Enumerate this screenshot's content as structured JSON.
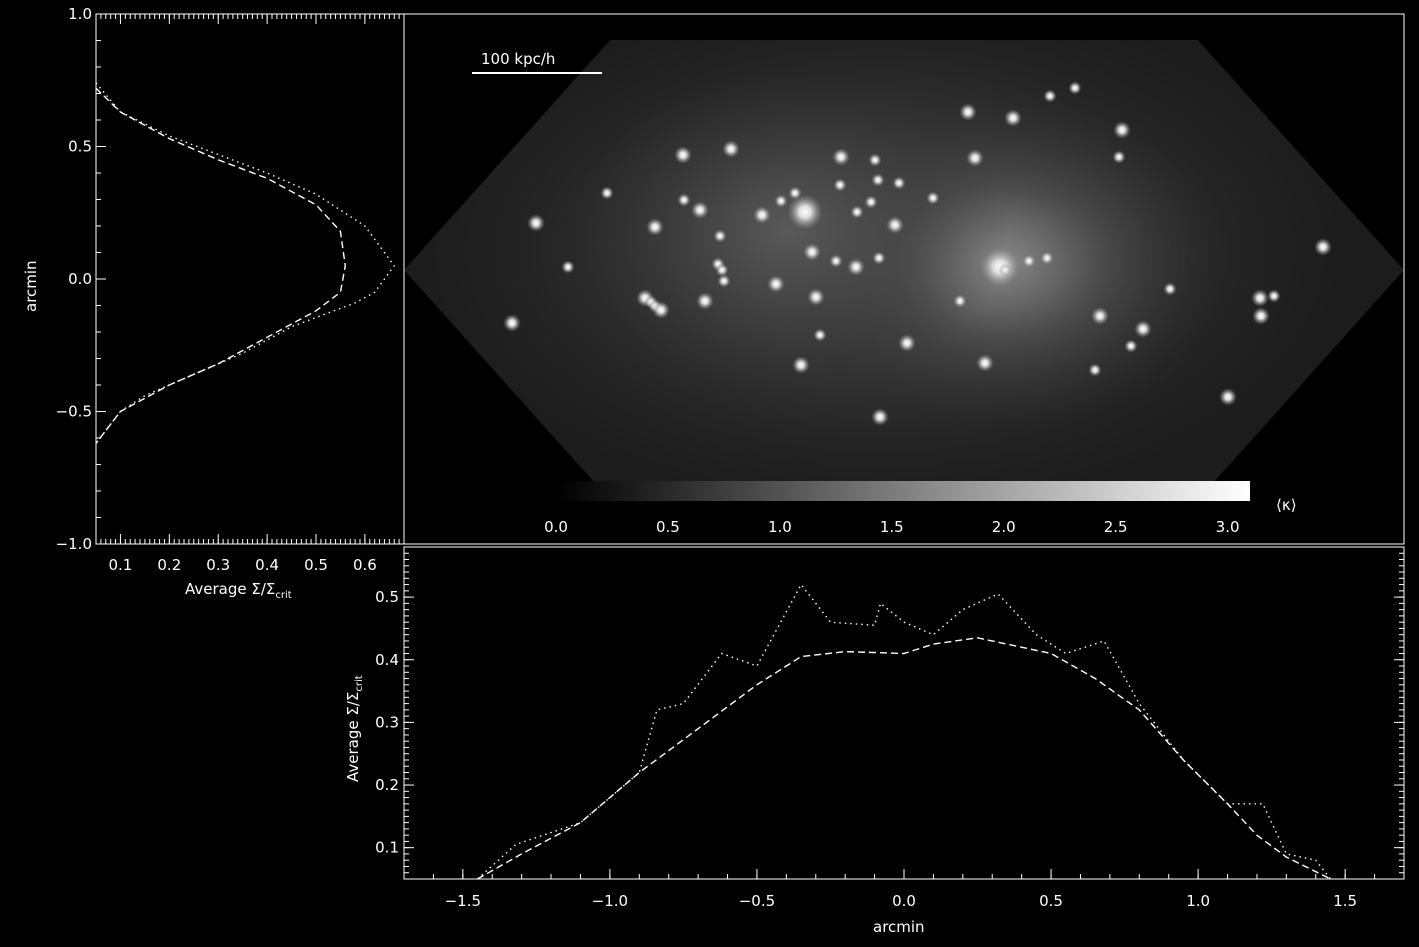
{
  "chart_data": [
    {
      "type": "heatmap",
      "panel": "map",
      "scale_bar_label": "100 kpc/h",
      "colorbar": {
        "label": "⟨κ⟩",
        "ticks": [
          "0.0",
          "0.5",
          "1.0",
          "1.5",
          "2.0",
          "2.5",
          "3.0"
        ],
        "range": [
          0.0,
          3.1
        ],
        "colors": [
          "#000000",
          "#ffffff"
        ]
      }
    },
    {
      "type": "line",
      "panel": "left-profile",
      "xlabel": "Average Σ/Σ",
      "xlabel_sub": "crit",
      "ylabel": "arcmin",
      "xticks": [
        "0.1",
        "0.2",
        "0.3",
        "0.4",
        "0.5",
        "0.6"
      ],
      "yticks": [
        "1.0",
        "0.5",
        "0.0",
        "−0.5",
        "−1.0"
      ],
      "xlim": [
        0.05,
        0.68
      ],
      "ylim": [
        -1.0,
        1.0
      ],
      "series": [
        {
          "style": "dashed",
          "points": [
            [
              0.05,
              0.72
            ],
            [
              0.1,
              0.63
            ],
            [
              0.2,
              0.53
            ],
            [
              0.3,
              0.45
            ],
            [
              0.4,
              0.38
            ],
            [
              0.5,
              0.28
            ],
            [
              0.55,
              0.18
            ],
            [
              0.56,
              0.05
            ],
            [
              0.55,
              -0.05
            ],
            [
              0.5,
              -0.12
            ],
            [
              0.4,
              -0.22
            ],
            [
              0.3,
              -0.32
            ],
            [
              0.2,
              -0.4
            ],
            [
              0.1,
              -0.5
            ],
            [
              0.05,
              -0.62
            ]
          ]
        },
        {
          "style": "dotted",
          "points": [
            [
              0.05,
              0.74
            ],
            [
              0.1,
              0.63
            ],
            [
              0.2,
              0.54
            ],
            [
              0.3,
              0.47
            ],
            [
              0.4,
              0.4
            ],
            [
              0.5,
              0.32
            ],
            [
              0.6,
              0.2
            ],
            [
              0.66,
              0.05
            ],
            [
              0.62,
              -0.05
            ],
            [
              0.58,
              -0.09
            ],
            [
              0.45,
              -0.18
            ],
            [
              0.35,
              -0.28
            ],
            [
              0.25,
              -0.36
            ],
            [
              0.15,
              -0.44
            ],
            [
              0.1,
              -0.5
            ],
            [
              0.05,
              -0.62
            ]
          ]
        }
      ]
    },
    {
      "type": "line",
      "panel": "bottom-profile",
      "xlabel": "arcmin",
      "ylabel": "Average Σ/Σ",
      "ylabel_sub": "crit",
      "xticks": [
        "−1.5",
        "−1.0",
        "−0.5",
        "0.0",
        "0.5",
        "1.0",
        "1.5"
      ],
      "yticks": [
        "0.1",
        "0.2",
        "0.3",
        "0.4",
        "0.5"
      ],
      "xlim": [
        -1.7,
        1.7
      ],
      "ylim": [
        0.05,
        0.58
      ],
      "series": [
        {
          "style": "dashed",
          "points": [
            [
              -1.45,
              0.05
            ],
            [
              -1.3,
              0.09
            ],
            [
              -1.1,
              0.14
            ],
            [
              -0.9,
              0.22
            ],
            [
              -0.7,
              0.29
            ],
            [
              -0.5,
              0.36
            ],
            [
              -0.35,
              0.405
            ],
            [
              -0.2,
              0.413
            ],
            [
              0.0,
              0.41
            ],
            [
              0.1,
              0.425
            ],
            [
              0.25,
              0.435
            ],
            [
              0.35,
              0.425
            ],
            [
              0.5,
              0.41
            ],
            [
              0.65,
              0.37
            ],
            [
              0.8,
              0.32
            ],
            [
              0.95,
              0.24
            ],
            [
              1.1,
              0.17
            ],
            [
              1.2,
              0.12
            ],
            [
              1.3,
              0.085
            ],
            [
              1.45,
              0.05
            ]
          ]
        },
        {
          "style": "dotted",
          "points": [
            [
              -1.45,
              0.05
            ],
            [
              -1.32,
              0.105
            ],
            [
              -1.1,
              0.14
            ],
            [
              -0.9,
              0.22
            ],
            [
              -0.84,
              0.32
            ],
            [
              -0.75,
              0.33
            ],
            [
              -0.62,
              0.41
            ],
            [
              -0.5,
              0.39
            ],
            [
              -0.35,
              0.52
            ],
            [
              -0.25,
              0.46
            ],
            [
              -0.1,
              0.455
            ],
            [
              -0.08,
              0.49
            ],
            [
              0.0,
              0.46
            ],
            [
              0.1,
              0.44
            ],
            [
              0.2,
              0.48
            ],
            [
              0.32,
              0.505
            ],
            [
              0.45,
              0.44
            ],
            [
              0.55,
              0.41
            ],
            [
              0.68,
              0.43
            ],
            [
              0.8,
              0.33
            ],
            [
              0.95,
              0.24
            ],
            [
              1.1,
              0.17
            ],
            [
              1.22,
              0.17
            ],
            [
              1.3,
              0.09
            ],
            [
              1.4,
              0.08
            ],
            [
              1.45,
              0.05
            ]
          ]
        }
      ]
    }
  ]
}
